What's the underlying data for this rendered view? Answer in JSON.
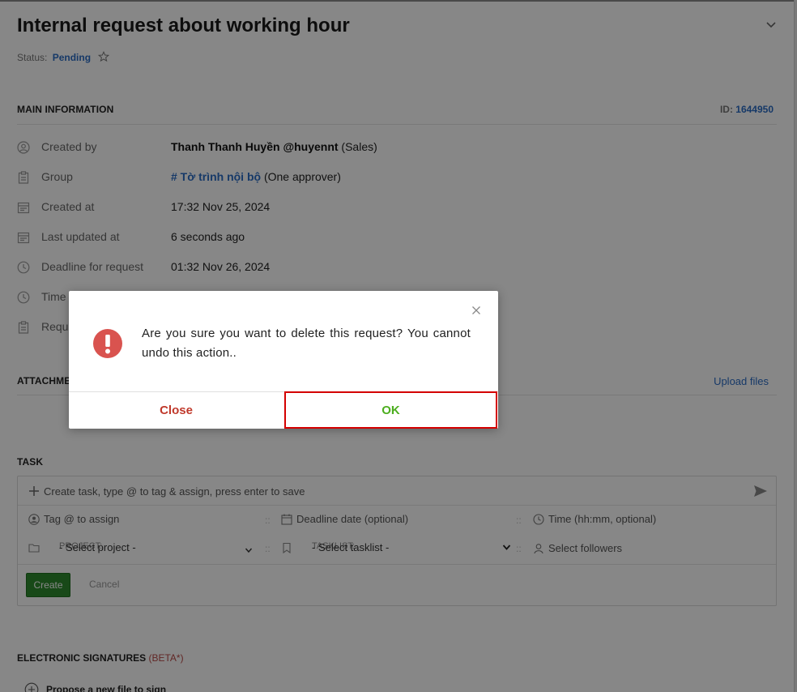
{
  "page": {
    "title": "Internal request about working hour",
    "status_label": "Status:",
    "status_value": "Pending",
    "main_info_title": "MAIN INFORMATION",
    "id_label": "ID:",
    "id_value": "1644950"
  },
  "info_rows": [
    {
      "label": "Created by",
      "value_bold": "Thanh Thanh Huyền @huyennt",
      "value_rest": " (Sales)",
      "icon": "user-circle-icon"
    },
    {
      "label": "Group",
      "value_link": "# Tờ trình nội bộ",
      "value_rest": " (One approver)",
      "icon": "clipboard-icon"
    },
    {
      "label": "Created at",
      "value": "17:32 Nov 25, 2024",
      "icon": "calendar-icon"
    },
    {
      "label": "Last updated at",
      "value": "6 seconds ago",
      "icon": "calendar-icon"
    },
    {
      "label": "Deadline for request",
      "value": "01:32 Nov 26, 2024",
      "icon": "clock-icon"
    },
    {
      "label": "Time",
      "icon": "clock-icon"
    },
    {
      "label": "Requ",
      "icon": "clipboard-icon"
    }
  ],
  "attachments": {
    "title": "ATTACHME",
    "upload_label": "Upload files"
  },
  "task": {
    "title": "TASK",
    "input_placeholder": "Create task, type @ to tag & assign, press enter to save",
    "tag_assign": "Tag @ to assign",
    "deadline_date": "Deadline date (optional)",
    "time_optional": "Time (hh:mm, optional)",
    "project_label": "PROJECT:",
    "project_value": "- Select project -",
    "tasklist_label": "TASKLIST:",
    "tasklist_value": "- Select tasklist -",
    "followers": "Select followers",
    "create_label": "Create",
    "cancel_label": "Cancel",
    "separator": "::"
  },
  "signatures": {
    "title": "ELECTRONIC SIGNATURES",
    "beta": "(BETA*)",
    "propose": "Propose a new file to sign"
  },
  "dialog": {
    "message": "Are you sure you want to delete this request? You cannot undo this action..",
    "close_label": "Close",
    "ok_label": "OK",
    "colors": {
      "danger": "#d9534f",
      "ok": "#4cae1e",
      "highlight": "#d40000"
    }
  }
}
